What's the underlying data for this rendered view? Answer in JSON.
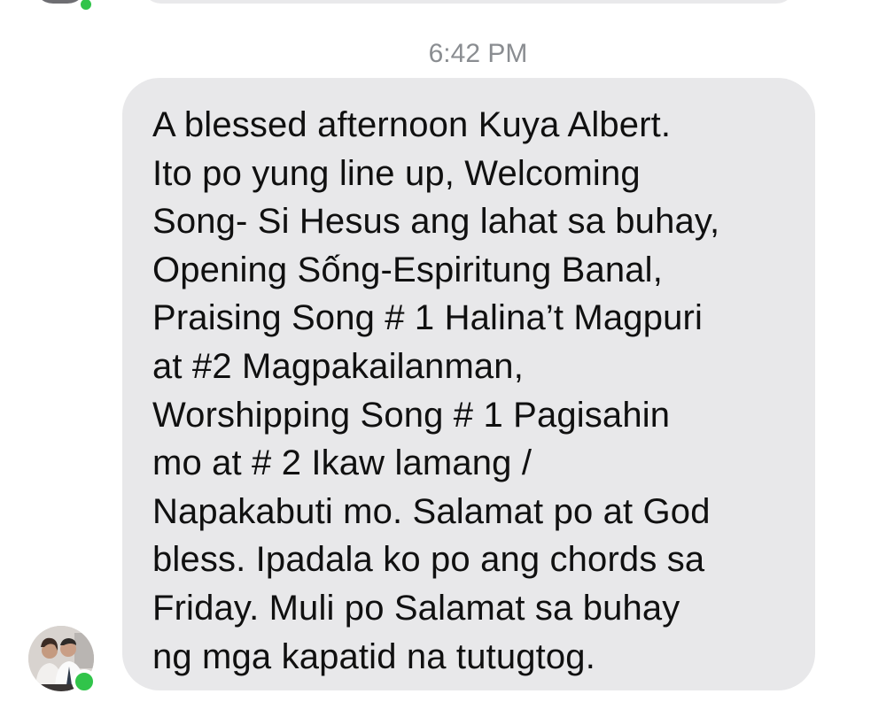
{
  "thread": {
    "timestamp": "6:42 PM",
    "message": {
      "text": "A blessed afternoon Kuya Albert.\nIto po yung line up, Welcoming\nSong- Si Hesus ang lahat sa buhay,\nOpening Sống-Espiritung Banal,\nPraising Song # 1 Halina’t Magpuri\nat #2 Magpakailanman,\nWorshipping Song # 1 Pagisahin\nmo at # 2 Ikaw lamang /\nNapakabuti mo. Salamat po at God\nbless. Ipadala ko po ang chords sa\nFriday. Muli po Salamat sa buhay\nng mga kapatid na tutugtog.",
      "sender_online": true
    }
  },
  "colors": {
    "bubble": "#e8e8ea",
    "timestamp": "#8a8d91",
    "text": "#101010",
    "online": "#31c44a"
  },
  "icons": {
    "avatar": "sender-avatar",
    "presence": "online-status-dot"
  }
}
